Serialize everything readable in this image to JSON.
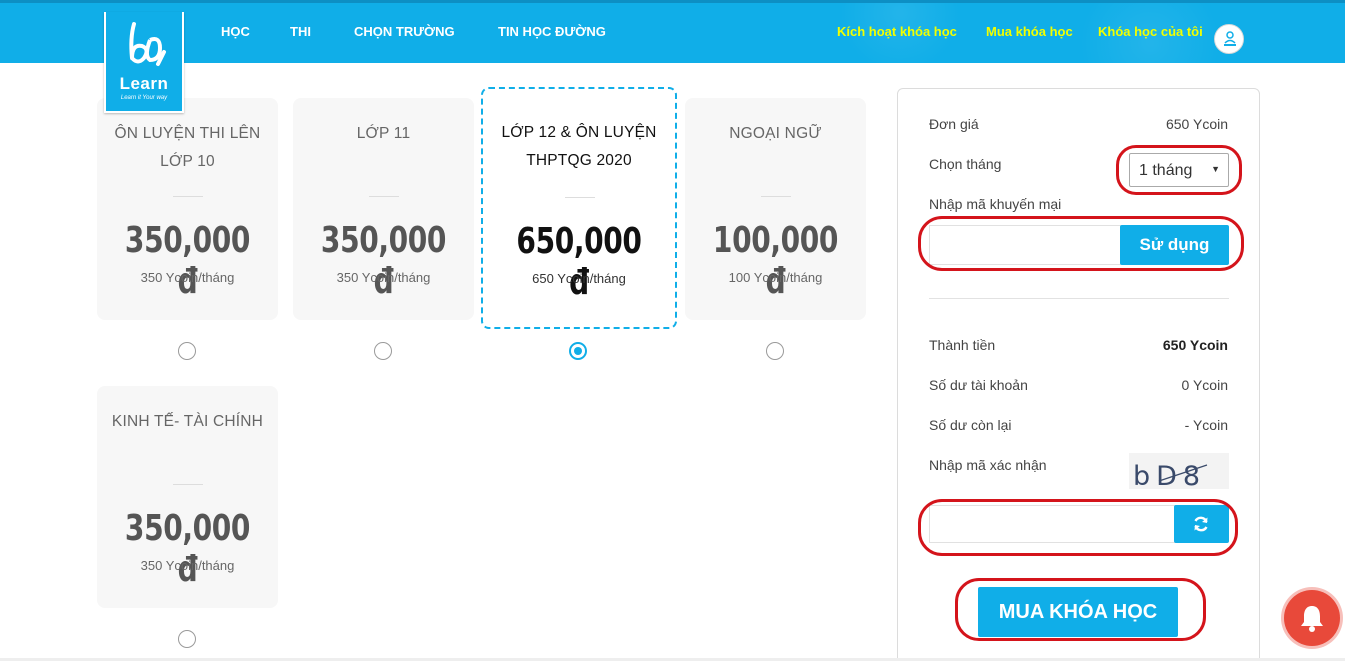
{
  "header": {
    "logo_text": "Learn",
    "logo_tagline": "Learn it Your way",
    "nav": [
      "HỌC",
      "THI",
      "CHỌN TRƯỜNG",
      "TIN HỌC ĐƯỜNG"
    ],
    "right_links": [
      "Kích hoạt khóa học",
      "Mua khóa học",
      "Khóa học của tôi"
    ]
  },
  "courses": [
    {
      "title": "ÔN LUYỆN THI LÊN LỚP 10",
      "price": "350,000 đ",
      "per_month": "350 Ycoin/tháng",
      "selected": false
    },
    {
      "title": "LỚP 11",
      "price": "350,000 đ",
      "per_month": "350 Ycoin/tháng",
      "selected": false
    },
    {
      "title": "LỚP 12 & ÔN LUYỆN THPTQG 2020",
      "price": "650,000 đ",
      "per_month": "650 Ycoin/tháng",
      "selected": true
    },
    {
      "title": "NGOẠI NGỮ",
      "price": "100,000 đ",
      "per_month": "100 Ycoin/tháng",
      "selected": false
    },
    {
      "title": "KINH TẾ- TÀI CHÍNH",
      "price": "350,000 đ",
      "per_month": "350 Ycoin/tháng",
      "selected": false
    }
  ],
  "panel": {
    "unit_price_label": "Đơn giá",
    "unit_price_value": "650 Ycoin",
    "month_label": "Chọn tháng",
    "month_value": "1 tháng",
    "promo_label": "Nhập mã khuyến mại",
    "promo_value": "",
    "use_button": "Sử dụng",
    "total_label": "Thành tiền",
    "total_value": "650 Ycoin",
    "balance_label": "Số dư tài khoản",
    "balance_value": "0 Ycoin",
    "remaining_label": "Số dư còn lại",
    "remaining_value": "- Ycoin",
    "captcha_label": "Nhập mã xác nhận",
    "captcha_text": "bD8",
    "captcha_value": "",
    "buy_button": "MUA KHÓA HỌC"
  },
  "colors": {
    "brand": "#10aee8",
    "highlight_link": "#f2ff00",
    "annotation": "#d4141b",
    "notification": "#e8493a"
  },
  "icons": {
    "refresh": "refresh-icon",
    "bell": "bell-icon",
    "select_arrow": "caret-down-icon"
  }
}
